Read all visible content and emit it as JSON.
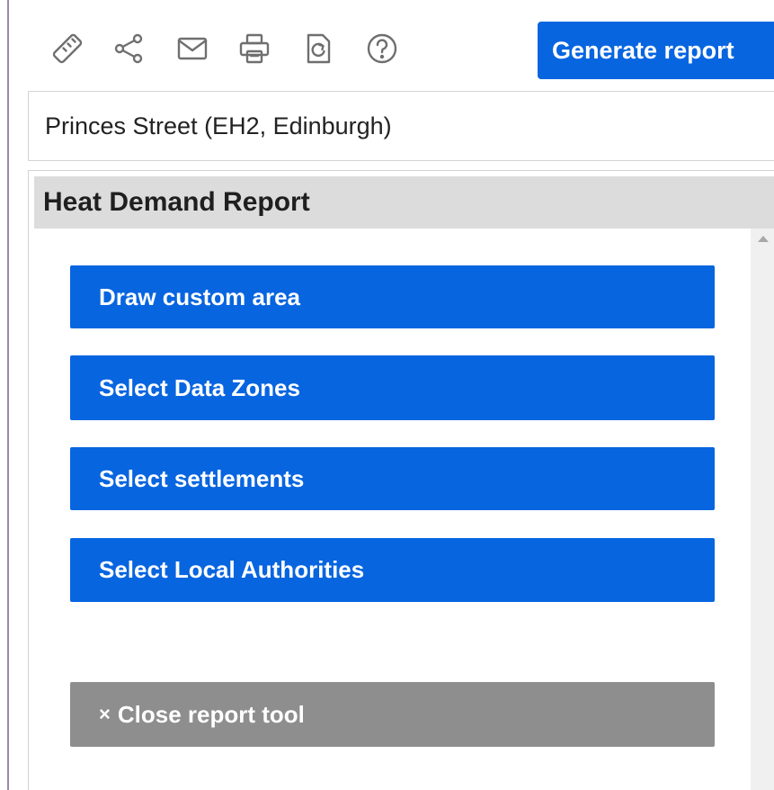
{
  "toolbar": {
    "icons": [
      "ruler-icon",
      "share-icon",
      "email-icon",
      "print-icon",
      "refresh-document-icon",
      "help-icon"
    ],
    "generate_report_label": "Generate report"
  },
  "location": {
    "text": "Princes Street (EH2, Edinburgh)"
  },
  "panel": {
    "title": "Heat Demand Report",
    "buttons": [
      {
        "label": "Draw custom area"
      },
      {
        "label": "Select Data Zones"
      },
      {
        "label": "Select settlements"
      },
      {
        "label": "Select Local Authorities"
      }
    ],
    "close_glyph": "×",
    "close_label": "Close report tool"
  },
  "colors": {
    "primary_button": "#0765e0",
    "close_button": "#8e8e8e",
    "header_background": "#dcdcdc",
    "icon_gray": "#6f6f6f"
  }
}
